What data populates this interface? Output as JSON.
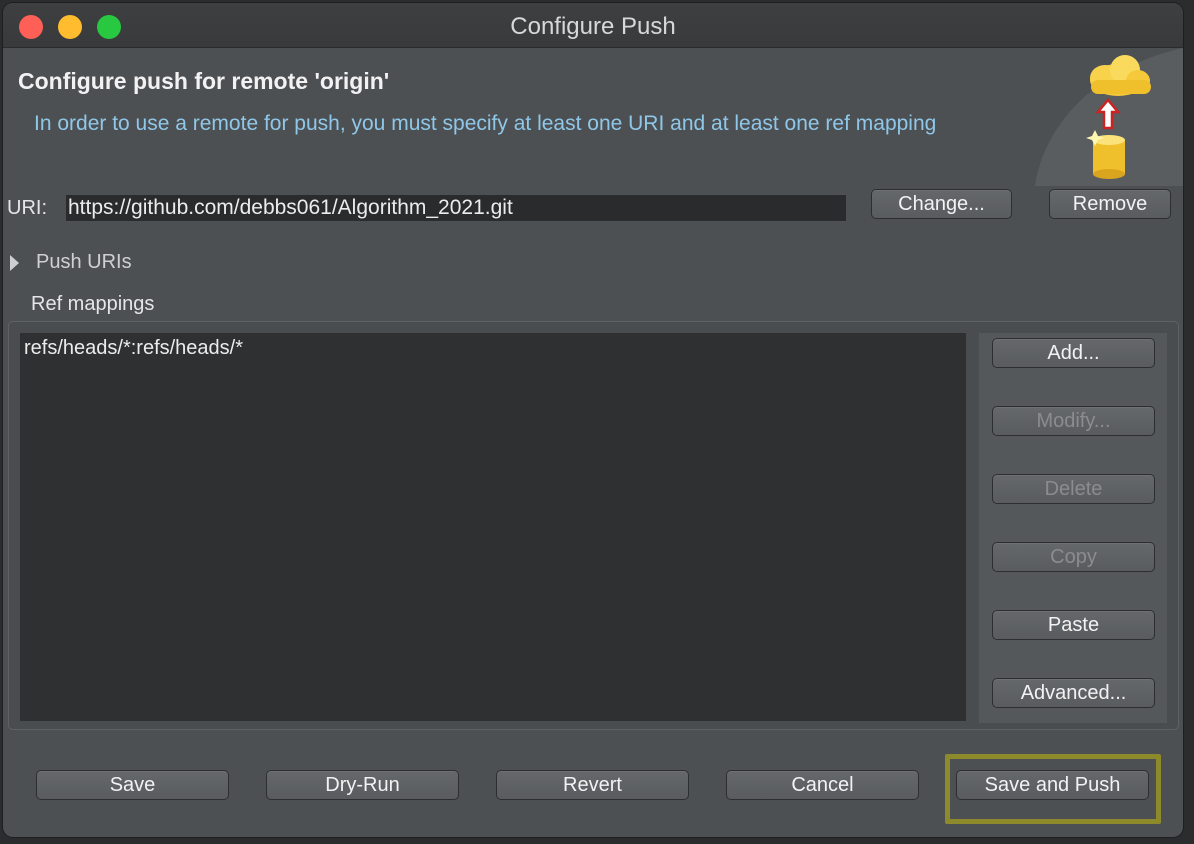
{
  "window": {
    "title": "Configure Push"
  },
  "header": {
    "title": "Configure push for remote 'origin'",
    "description": "In order to use a remote for push, you must specify at least one URI and at least one ref mapping"
  },
  "uri": {
    "label": "URI:",
    "value": "https://github.com/debbs061/Algorithm_2021.git",
    "change_label": "Change...",
    "remove_label": "Remove"
  },
  "push_uris": {
    "label": "Push URIs",
    "expanded": false
  },
  "ref_mappings": {
    "label": "Ref mappings",
    "items": [
      "refs/heads/*:refs/heads/*"
    ],
    "buttons": {
      "add": "Add...",
      "modify": "Modify...",
      "delete": "Delete",
      "copy": "Copy",
      "paste": "Paste",
      "advanced": "Advanced..."
    }
  },
  "footer": {
    "save": "Save",
    "dry_run": "Dry-Run",
    "revert": "Revert",
    "cancel": "Cancel",
    "save_and_push": "Save and Push"
  },
  "colors": {
    "window_bg": "#4d5053",
    "description_text": "#8fc7e8",
    "highlight_border": "#8c8a2b",
    "close": "#fe5f57",
    "minimize": "#febc2e",
    "maximize": "#28c840"
  }
}
